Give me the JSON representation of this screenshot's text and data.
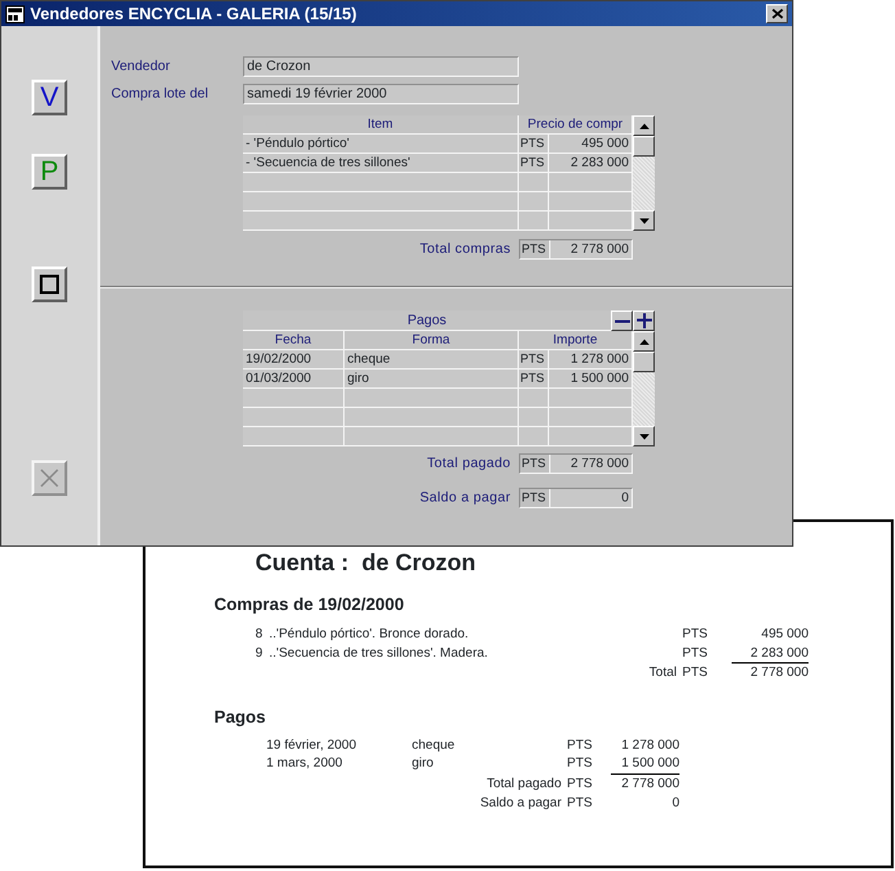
{
  "window": {
    "title": "Vendedores ENCYCLIA - GALERIA (15/15)"
  },
  "side_buttons": [
    {
      "kind": "letter",
      "label": "V",
      "color": "#1414c8",
      "disabled": false
    },
    {
      "kind": "letter",
      "label": "P",
      "color": "#0e8a0e",
      "disabled": false
    },
    {
      "kind": "square",
      "disabled": false
    },
    {
      "kind": "close",
      "disabled": true
    }
  ],
  "fields": [
    {
      "label": "Vendedor",
      "value": "de Crozon"
    },
    {
      "label": "Compra lote del",
      "value": "samedi 19 février 2000"
    }
  ],
  "items_table": {
    "columns": [
      "Item",
      "Precio de compr"
    ],
    "rows": [
      {
        "item": "- 'Péndulo pórtico'",
        "currency": "PTS",
        "price": "495 000"
      },
      {
        "item": "- 'Secuencia de tres sillones'",
        "currency": "PTS",
        "price": "2 283 000"
      }
    ]
  },
  "total_compras": {
    "label": "Total compras",
    "currency": "PTS",
    "value": "2 778 000"
  },
  "payments_table": {
    "title": "Pagos",
    "columns": [
      "Fecha",
      "Forma",
      "Importe"
    ],
    "rows": [
      {
        "date": "19/02/2000",
        "form": "cheque",
        "currency": "PTS",
        "amount": "1 278 000"
      },
      {
        "date": "01/03/2000",
        "form": "giro",
        "currency": "PTS",
        "amount": "1 500 000"
      }
    ]
  },
  "totals": [
    {
      "label": "Total pagado",
      "currency": "PTS",
      "value": "2 778 000"
    },
    {
      "label": "Saldo a pagar",
      "currency": "PTS",
      "value": "0"
    }
  ],
  "document": {
    "title": "Cuenta :  de Crozon",
    "purchases": {
      "heading": "Compras de 19/02/2000",
      "rows": [
        {
          "number": "8",
          "description": "..'Péndulo pórtico'. Bronce dorado.",
          "currency": "PTS",
          "amount": "495 000"
        },
        {
          "number": "9",
          "description": "..'Secuencia de tres sillones'. Madera.",
          "currency": "PTS",
          "amount": "2 283 000"
        }
      ],
      "total": {
        "label": "Total",
        "currency": "PTS",
        "value": "2 778 000"
      }
    },
    "payments": {
      "heading": "Pagos",
      "rows": [
        {
          "date": "19 février, 2000",
          "form": "cheque",
          "currency": "PTS",
          "amount": "1 278 000"
        },
        {
          "date": "1 mars, 2000",
          "form": "giro",
          "currency": "PTS",
          "amount": "1 500 000"
        }
      ],
      "totals": [
        {
          "label": "Total pagado",
          "currency": "PTS",
          "value": "2 778 000"
        },
        {
          "label": "Saldo a pagar",
          "currency": "PTS",
          "value": "0"
        }
      ]
    }
  }
}
